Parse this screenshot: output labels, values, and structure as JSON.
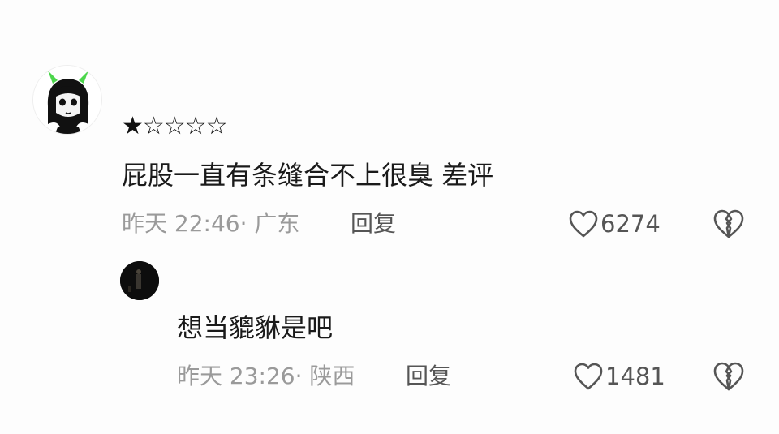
{
  "comments": [
    {
      "rating": "★☆☆☆☆",
      "text": "屁股一直有条缝合不上很臭 差评",
      "meta": "昨天 22:46· 广东",
      "reply_label": "回复",
      "likes": "6274",
      "rating_value": 1,
      "rating_max": 5
    },
    {
      "text": "想当貔貅是吧",
      "meta": "昨天 23:26· 陕西",
      "reply_label": "回复",
      "likes": "1481"
    }
  ],
  "icons": {
    "like": "heart-outline-icon",
    "dislike": "broken-heart-icon"
  }
}
